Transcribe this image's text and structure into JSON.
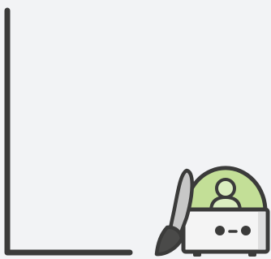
{
  "colors": {
    "background": "#f2f3f5",
    "outline": "#3b3b3a",
    "brush_handle": "#c7c7c7",
    "brush_bristles": "#4a4a49",
    "dome": "#c3df97",
    "dome_inner": "#dbeec0",
    "box_body": "#f4f4f4",
    "box_right_face": "#dedede",
    "face_features": "#3b3b3a"
  },
  "icons": {
    "axis": "axis-frame-icon",
    "mascot": "robot-artist-icon",
    "brush": "paintbrush-icon",
    "dome": "dome-icon",
    "figure": "person-icon",
    "face": "robot-face-icon"
  }
}
